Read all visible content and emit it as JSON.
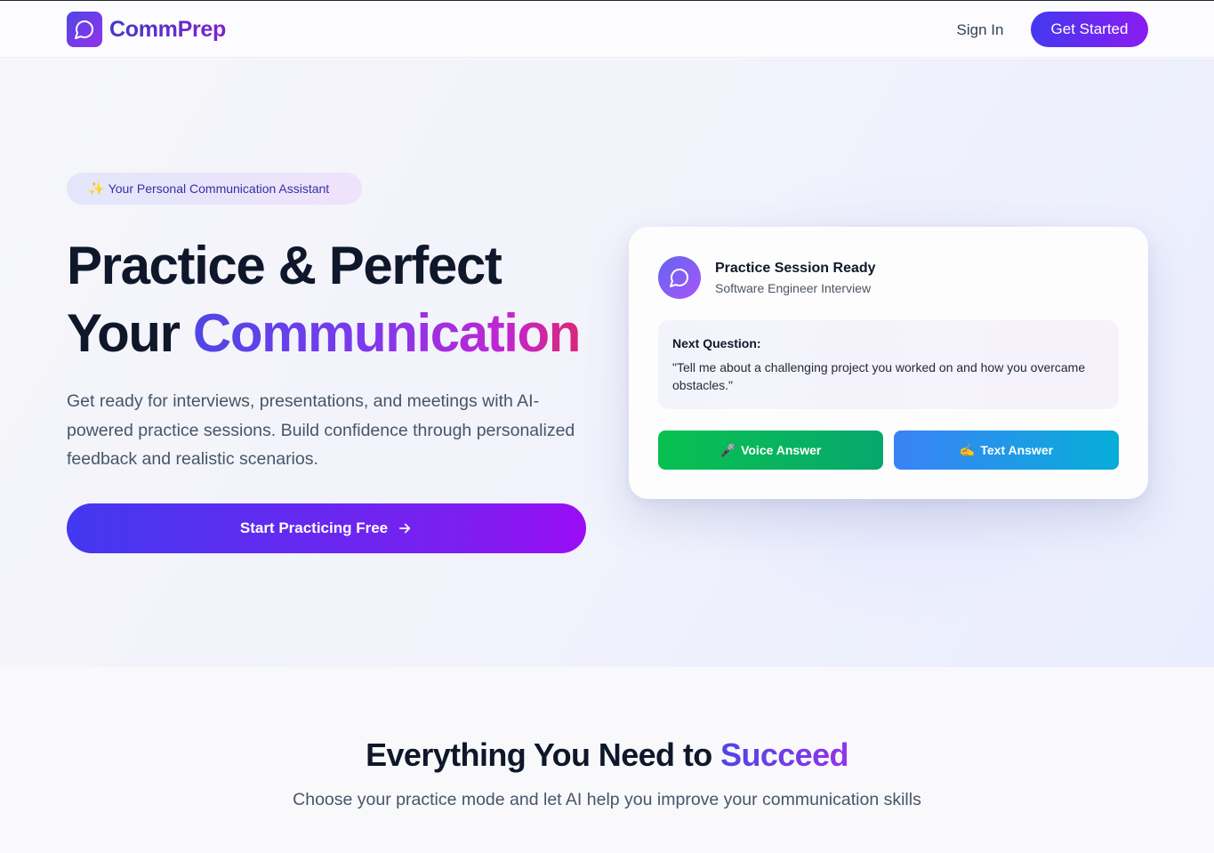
{
  "header": {
    "brand": "CommPrep",
    "sign_in": "Sign In",
    "get_started": "Get Started"
  },
  "hero": {
    "badge_icon": "✨",
    "badge_text": "Your Personal Communication Assistant",
    "headline_line1": "Practice & Perfect",
    "headline_line2_prefix": "Your",
    "headline_line2_highlight": "Communication",
    "lead": "Get ready for interviews, presentations, and meetings with AI-powered practice sessions. Build confidence through personalized feedback and realistic scenarios.",
    "cta_label": "Start Practicing Free"
  },
  "session_card": {
    "title": "Practice Session Ready",
    "subtitle": "Software Engineer Interview",
    "question_label": "Next Question:",
    "question_text": "\"Tell me about a challenging project you worked on and how you overcame obstacles.\"",
    "voice_icon": "🎤",
    "voice_label": "Voice Answer",
    "text_icon": "✍️",
    "text_label": "Text Answer"
  },
  "features": {
    "title_prefix": "Everything You Need to",
    "title_highlight": "Succeed",
    "subtitle": "Choose your practice mode and let AI help you improve your communication skills"
  },
  "icons": {
    "logo": "chat-bubble-icon",
    "card_avatar": "chat-bubble-icon",
    "cta_arrow": "arrow-right-icon"
  },
  "colors": {
    "brand_indigo": "#4338f0",
    "brand_purple": "#8b1cf0",
    "voice_green": "#08c150",
    "text_blue": "#3b82f6"
  }
}
